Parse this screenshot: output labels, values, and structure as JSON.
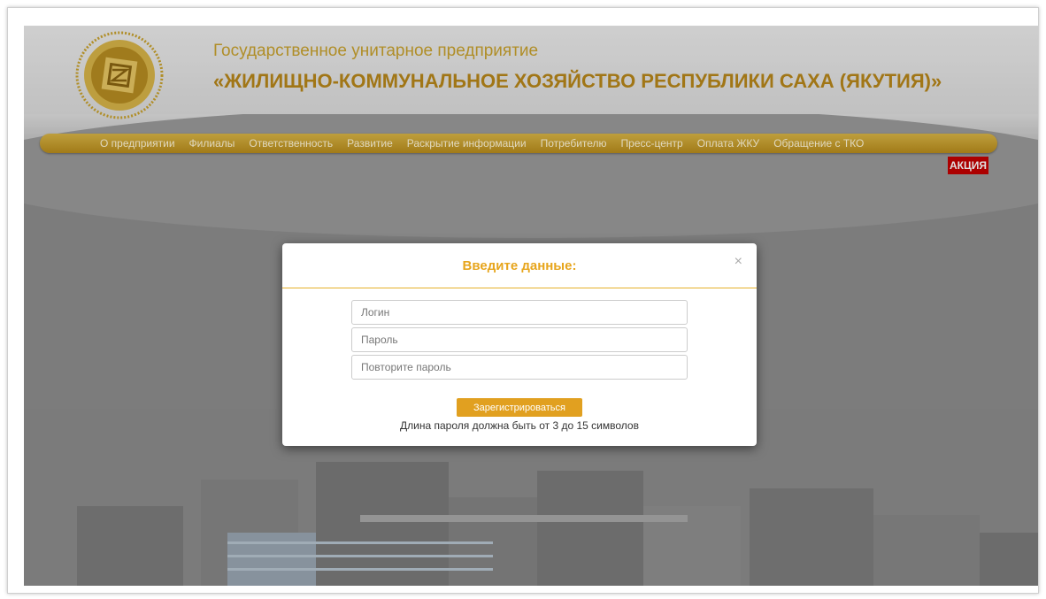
{
  "header": {
    "title_line1": "Государственное унитарное предприятие",
    "title_line2": "«ЖИЛИЩНО-КОММУНАЛЬНОЕ ХОЗЯЙСТВО РЕСПУБЛИКИ САХА (ЯКУТИЯ)»",
    "logo_icon": "emblem-icon"
  },
  "nav": {
    "items": [
      {
        "label": "О предприятии"
      },
      {
        "label": "Филиалы"
      },
      {
        "label": "Ответственность"
      },
      {
        "label": "Развитие"
      },
      {
        "label": "Раскрытие информации"
      },
      {
        "label": "Потребителю"
      },
      {
        "label": "Пресс-центр"
      },
      {
        "label": "Оплата ЖКУ"
      },
      {
        "label": "Обращение с ТКО"
      }
    ],
    "promo_label": "АКЦИЯ"
  },
  "modal": {
    "title": "Введите данные:",
    "close_label": "×",
    "login_placeholder": "Логин",
    "password_placeholder": "Пароль",
    "repeat_placeholder": "Повторите пароль",
    "register_label": "Зарегистрироваться",
    "hint": "Длина пароля должна быть от 3 до 15 символов"
  },
  "colors": {
    "accent": "#e1a020",
    "title_gold": "#b8871a",
    "promo_red": "#c40000"
  }
}
